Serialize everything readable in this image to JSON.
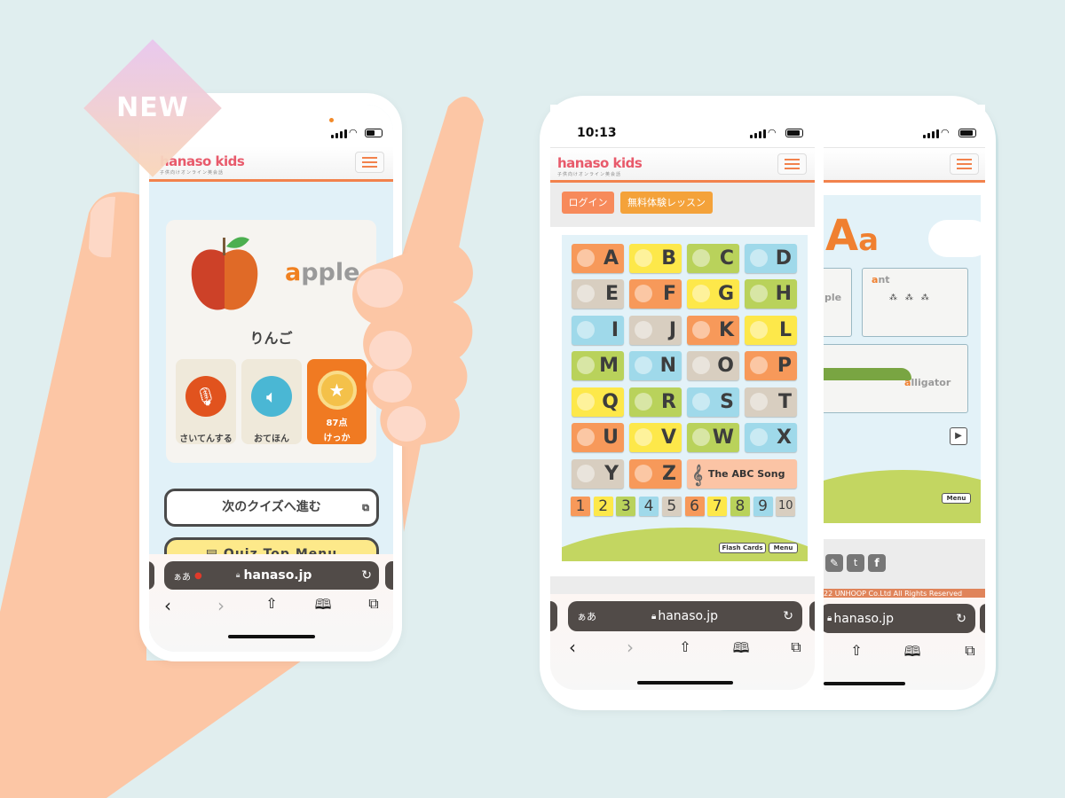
{
  "badge": {
    "label": "NEW",
    "colors": [
      "#e9c6ee",
      "#f9d6b8"
    ]
  },
  "colors": {
    "background": "#e0eeef",
    "hand": "#fcc6a5",
    "accent": "#f2824c",
    "tile_orange": "#f7995a",
    "tile_yellow": "#fde84a",
    "tile_green": "#b9d25b",
    "tile_blue": "#9fd9ea",
    "tile_tan": "#d8cec0"
  },
  "left_phone": {
    "header": {
      "logo": "hanaso kids",
      "logo_sub": "子供向けオンライン英会話"
    },
    "quiz": {
      "word_first": "a",
      "word_rest": "pple",
      "word_ja": "りんご",
      "tiles": [
        {
          "label": "さいてんする",
          "icon": "microphone-icon"
        },
        {
          "label": "おてほん",
          "icon": "speaker-icon"
        },
        {
          "label": "けっか",
          "score": "87点",
          "icon": "star-medal-icon"
        }
      ]
    },
    "next_button": "次のクイズへ進む",
    "menu_button": "Quiz Top Menu",
    "safari": {
      "aa": "ぁあ",
      "url": "hanaso.jp"
    }
  },
  "right_phone": {
    "status_time": "10:13",
    "header": {
      "logo": "hanaso kids",
      "logo_sub": "子供向けオンライン英会話"
    },
    "buttons": {
      "login": "ログイン",
      "trial": "無料体験レッスン"
    },
    "letters": [
      {
        "l": "A",
        "c": "o",
        "icon": "apple"
      },
      {
        "l": "B",
        "c": "y",
        "icon": "book"
      },
      {
        "l": "C",
        "c": "g",
        "icon": "cat"
      },
      {
        "l": "D",
        "c": "b",
        "icon": "dog"
      },
      {
        "l": "E",
        "c": "t",
        "icon": "elephant"
      },
      {
        "l": "F",
        "c": "o",
        "icon": "frog"
      },
      {
        "l": "G",
        "c": "y",
        "icon": "gift"
      },
      {
        "l": "H",
        "c": "g",
        "icon": "horse"
      },
      {
        "l": "I",
        "c": "b",
        "icon": "ink"
      },
      {
        "l": "J",
        "c": "t",
        "icon": "juice"
      },
      {
        "l": "K",
        "c": "o",
        "icon": "kiwi"
      },
      {
        "l": "L",
        "c": "y",
        "icon": "lemon"
      },
      {
        "l": "M",
        "c": "g",
        "icon": "monkey"
      },
      {
        "l": "N",
        "c": "b",
        "icon": "nose"
      },
      {
        "l": "O",
        "c": "t",
        "icon": "orange"
      },
      {
        "l": "P",
        "c": "o",
        "icon": "pig"
      },
      {
        "l": "Q",
        "c": "y",
        "icon": "queen"
      },
      {
        "l": "R",
        "c": "g",
        "icon": "rabbit"
      },
      {
        "l": "S",
        "c": "b",
        "icon": "star"
      },
      {
        "l": "T",
        "c": "t",
        "icon": "train"
      },
      {
        "l": "U",
        "c": "o",
        "icon": "umbrella"
      },
      {
        "l": "V",
        "c": "y",
        "icon": "violin"
      },
      {
        "l": "W",
        "c": "g",
        "icon": "whale"
      },
      {
        "l": "X",
        "c": "b",
        "icon": "box"
      },
      {
        "l": "Y",
        "c": "t",
        "icon": "yacht"
      },
      {
        "l": "Z",
        "c": "o",
        "icon": "zebra"
      }
    ],
    "abc_song": "The ABC Song",
    "numbers": [
      {
        "n": "1",
        "c": "o"
      },
      {
        "n": "2",
        "c": "y"
      },
      {
        "n": "3",
        "c": "g"
      },
      {
        "n": "4",
        "c": "b"
      },
      {
        "n": "5",
        "c": "t"
      },
      {
        "n": "6",
        "c": "o"
      },
      {
        "n": "7",
        "c": "y"
      },
      {
        "n": "8",
        "c": "g"
      },
      {
        "n": "9",
        "c": "b"
      },
      {
        "n": "10",
        "c": "t"
      }
    ],
    "flash_cards": "Flash Cards",
    "menu": "Menu",
    "safari": {
      "aa": "ぁあ",
      "url": "hanaso.jp"
    }
  },
  "right_screen2": {
    "big_letter": "A",
    "small_letter": "a",
    "cards": [
      {
        "first": "",
        "rest": "ple"
      },
      {
        "first": "a",
        "rest": "nt"
      },
      {
        "first": "a",
        "rest": "lligator"
      }
    ],
    "menu": "Menu",
    "copyright": "22 UNHOOP Co.Ltd All Rights Reserved",
    "safari": {
      "url": "hanaso.jp"
    }
  }
}
